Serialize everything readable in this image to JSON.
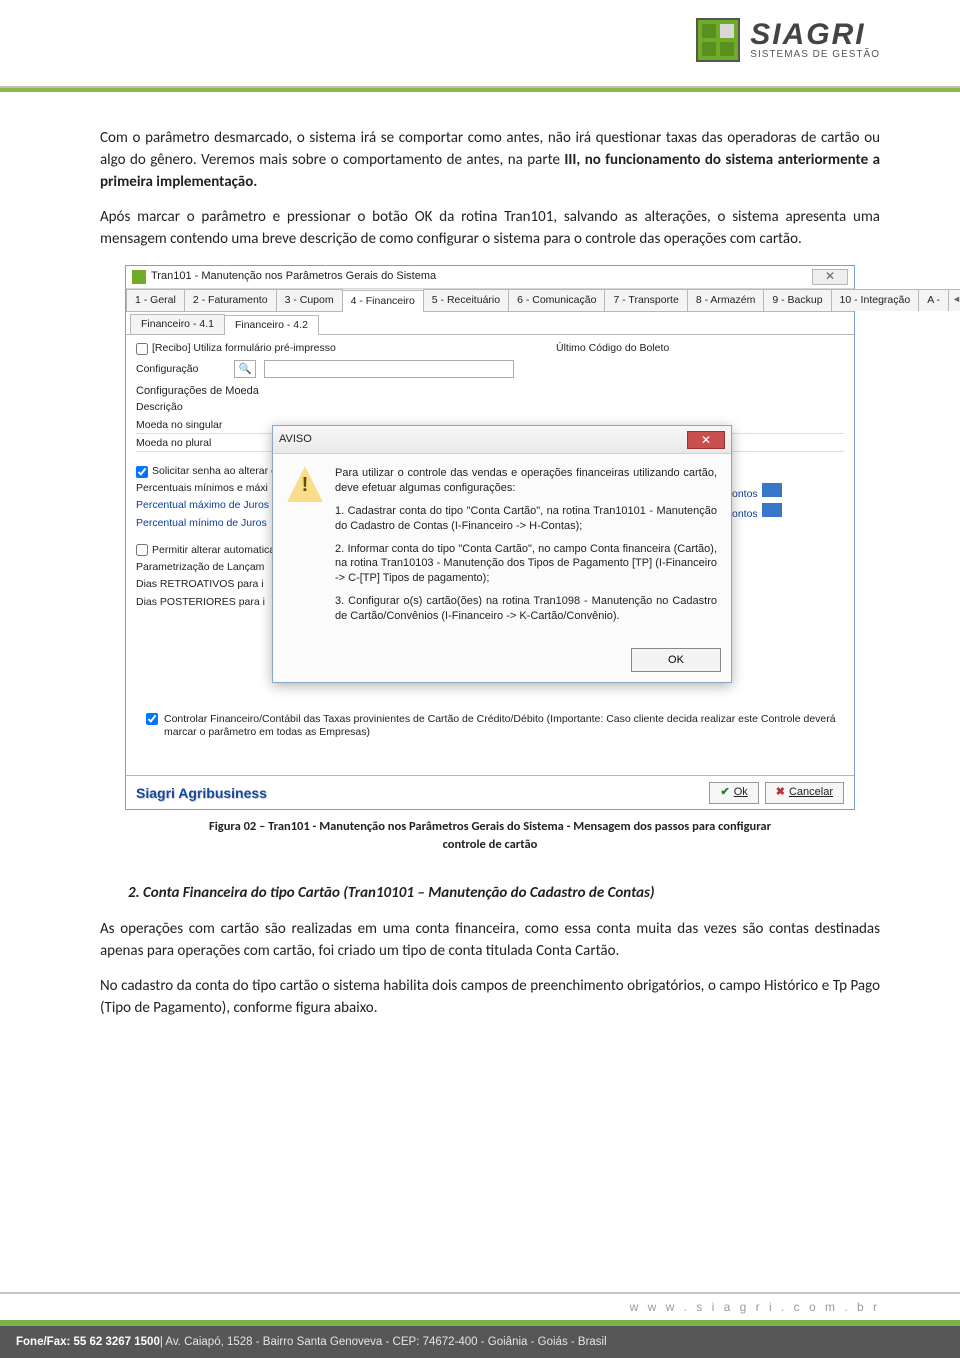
{
  "header": {
    "brand": "SIAGRI",
    "tagline": "SISTEMAS DE GESTÃO"
  },
  "paragraphs": {
    "p1a": "Com o parâmetro desmarcado, o sistema irá se comportar como antes, não irá questionar taxas das operadoras de cartão ou algo do gênero. Veremos mais sobre o comportamento de antes, na parte ",
    "p1b": "III, no funcionamento do sistema anteriormente a primeira implementação.",
    "p2": "Após marcar o parâmetro e pressionar o botão OK da rotina Tran101, salvando as alterações, o sistema apresenta uma mensagem contendo uma breve descrição de como configurar o sistema para o controle das operações com cartão."
  },
  "window": {
    "title": "Tran101 - Manutenção nos Parâmetros Gerais do Sistema",
    "tabs": [
      "1 - Geral",
      "2 - Faturamento",
      "3 - Cupom",
      "4 - Financeiro",
      "5 - Receituário",
      "6 - Comunicação",
      "7 - Transporte",
      "8 - Armazém",
      "9 - Backup",
      "10 - Integração",
      "A -"
    ],
    "subtabs": [
      "Financeiro - 4.1",
      "Financeiro - 4.2"
    ],
    "form": {
      "recibo": "[Recibo] Utiliza formulário pré-impresso",
      "configuracao": "Configuração",
      "ultimo_codigo": "Último Código do Boleto",
      "config_moeda": "Configurações de Moeda",
      "descricao": "Descrição",
      "moeda_singular": "Moeda no singular",
      "moeda_plural": "Moeda no plural",
      "solicitar": "Solicitar senha ao alterar o",
      "percentuais": "Percentuais mínimos e máxi",
      "perc_max": "Percentual máximo de Juros",
      "perc_min": "Percentual mínimo de Juros",
      "permitir": "Permitir alterar automaticam",
      "parametrizacao": "Parametrização de Lançam",
      "dias_retro": "Dias RETROATIVOS para i",
      "dias_post": "Dias POSTERIORES para i",
      "pontos": "ontos",
      "controlar": "Controlar Financeiro/Contábil das Taxas provinientes de Cartão de Crédito/Débito (Importante: Caso cliente decida realizar este Controle deverá marcar o parâmetro em todas as Empresas)"
    },
    "aviso": {
      "title": "AVISO",
      "intro": "Para utilizar o controle das vendas e operações financeiras utilizando cartão, deve efetuar algumas configurações:",
      "item1": "1. Cadastrar conta do tipo \"Conta Cartão\", na rotina Tran10101 - Manutenção do Cadastro de Contas (I-Financeiro -> H-Contas);",
      "item2": "2. Informar conta do tipo \"Conta Cartão\", no campo Conta financeira (Cartão), na rotina Tran10103 - Manutenção dos Tipos de Pagamento [TP] (I-Financeiro -> C-[TP] Tipos de pagamento);",
      "item3": "3. Configurar o(s) cartão(ões) na rotina Tran1098 - Manutenção no Cadastro de Cartão/Convênios (I-Financeiro -> K-Cartão/Convênio).",
      "ok": "OK"
    },
    "footer": {
      "brand": "Siagri Agribusiness",
      "ok": "Ok",
      "cancel": "Cancelar"
    }
  },
  "caption_line1": "Figura 02 – Tran101 - Manutenção nos Parâmetros Gerais do Sistema - Mensagem dos passos para configurar",
  "caption_line2": "controle de cartão",
  "subheading": "2.   Conta Financeira do tipo Cartão (Tran10101 – Manutenção do Cadastro de Contas)",
  "p3": "As operações com cartão são realizadas em uma conta financeira, como essa conta muita das vezes são contas destinadas apenas para operações com cartão, foi criado um tipo de conta titulada Conta Cartão.",
  "p4": "No cadastro da conta do tipo cartão o sistema habilita dois campos de preenchimento obrigatórios, o campo Histórico e Tp Pago (Tipo de Pagamento), conforme figura abaixo.",
  "footer": {
    "site": "w w w . s i a g r i . c o m . b r",
    "contact_a": "Fone/Fax: 55 62 3267 1500",
    "contact_b": " | Av. Caiapó, 1528 - Bairro Santa Genoveva - CEP: 74672-400 - Goiânia - Goiás - Brasil"
  }
}
